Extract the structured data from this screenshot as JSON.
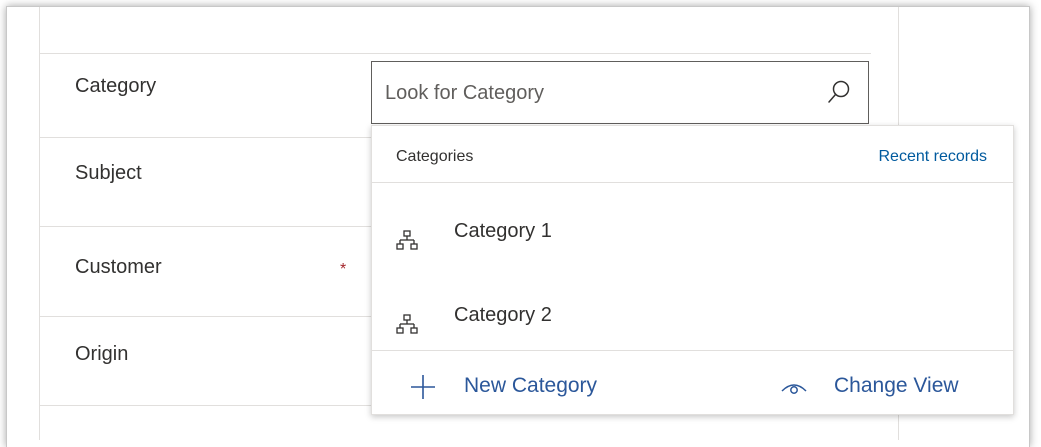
{
  "form": {
    "fields": [
      {
        "label": "Category",
        "required": false
      },
      {
        "label": "Subject",
        "required": false
      },
      {
        "label": "Customer",
        "required": true
      },
      {
        "label": "Origin",
        "required": false
      }
    ],
    "required_marker": "*"
  },
  "lookup": {
    "placeholder": "Look for Category",
    "icon": "search-icon"
  },
  "flyout": {
    "title": "Categories",
    "recent_link": "Recent records",
    "records": [
      {
        "label": "Category 1",
        "icon": "hierarchy-icon"
      },
      {
        "label": "Category 2",
        "icon": "hierarchy-icon"
      }
    ],
    "footer": {
      "new_label": "New Category",
      "change_view_label": "Change View"
    }
  },
  "colors": {
    "link": "#2b579a",
    "required": "#a4262c",
    "border": "#e1dfdd"
  }
}
